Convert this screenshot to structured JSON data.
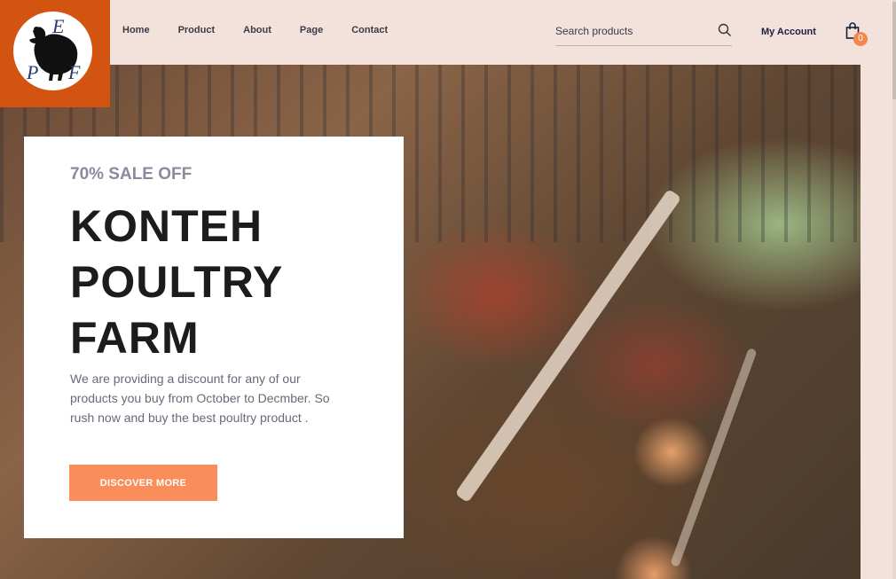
{
  "logo": {
    "letters": [
      "E",
      "P",
      "F"
    ],
    "icon": "hen-icon",
    "brand_color": "#d35410"
  },
  "nav": {
    "items": [
      {
        "label": "Home"
      },
      {
        "label": "Product"
      },
      {
        "label": "About"
      },
      {
        "label": "Page"
      },
      {
        "label": "Contact"
      }
    ]
  },
  "search": {
    "placeholder": "Search products",
    "icon": "search-icon"
  },
  "account": {
    "label": "My Account"
  },
  "cart": {
    "count": "0",
    "icon": "shopping-bag-icon"
  },
  "hero": {
    "sale_text": "70% SALE OFF",
    "title_lines": [
      "KONTEH",
      "POULTRY",
      "FARM"
    ],
    "description": "We are providing a discount for any of our products you buy from October to Decmber. So rush now and buy the best poultry product .",
    "cta_label": "DISCOVER MORE",
    "accent_color": "#f98e5a"
  }
}
